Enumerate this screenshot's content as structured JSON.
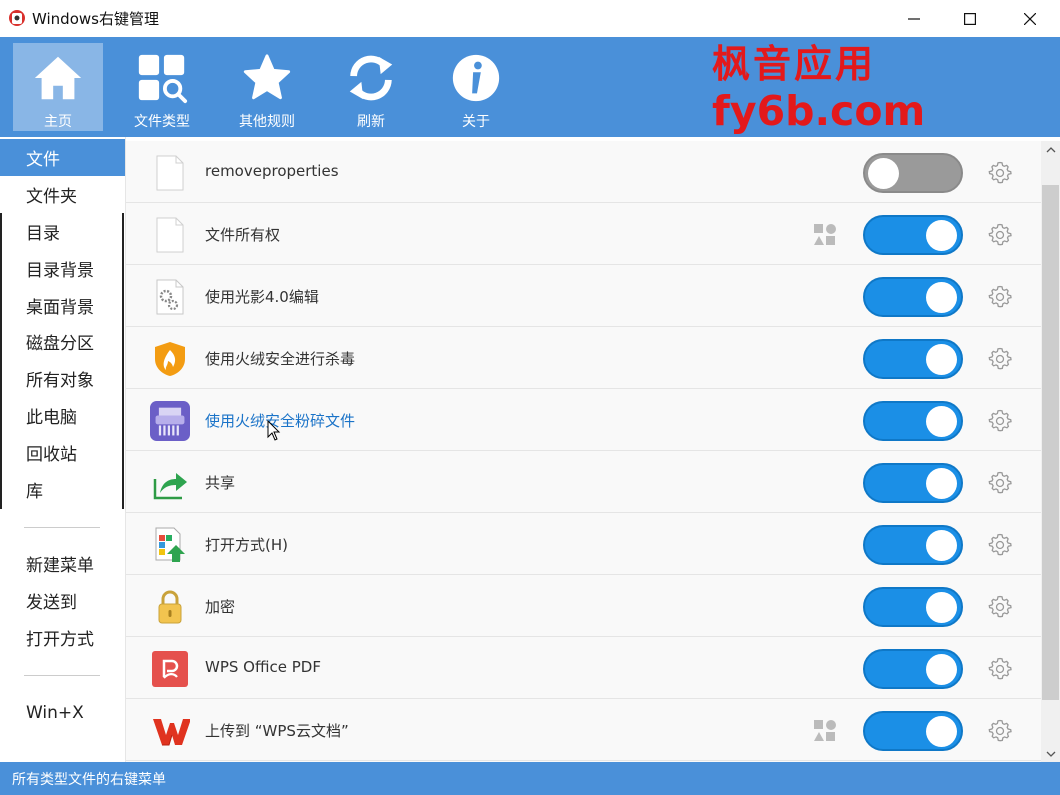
{
  "window": {
    "title": "Windows右键管理"
  },
  "toolbar": {
    "items": [
      {
        "label": "主页",
        "icon": "home-icon",
        "active": true
      },
      {
        "label": "文件类型",
        "icon": "file-types-icon",
        "active": false
      },
      {
        "label": "其他规则",
        "icon": "star-icon",
        "active": false
      },
      {
        "label": "刷新",
        "icon": "refresh-icon",
        "active": false
      },
      {
        "label": "关于",
        "icon": "info-icon",
        "active": false
      }
    ],
    "watermark_line1": "枫音应用",
    "watermark_line2": "fy6b.com"
  },
  "sidebar": {
    "items": [
      {
        "label": "文件",
        "selected": true
      },
      {
        "label": "文件夹"
      },
      {
        "label": "目录"
      },
      {
        "label": "目录背景"
      },
      {
        "label": "桌面背景"
      },
      {
        "label": "磁盘分区"
      },
      {
        "label": "所有对象"
      },
      {
        "label": "此电脑"
      },
      {
        "label": "回收站"
      },
      {
        "label": "库"
      },
      {
        "label": "新建菜单"
      },
      {
        "label": "发送到"
      },
      {
        "label": "打开方式"
      },
      {
        "label": "Win+X"
      }
    ]
  },
  "list": {
    "rows": [
      {
        "name": "removeproperties",
        "icon": "blank-file-icon",
        "enabled": false,
        "shared_badge": false
      },
      {
        "name": "文件所有权",
        "icon": "blank-file-icon",
        "enabled": true,
        "shared_badge": true
      },
      {
        "name": "使用光影4.0编辑",
        "icon": "gear-file-icon",
        "enabled": true,
        "shared_badge": false
      },
      {
        "name": "使用火绒安全进行杀毒",
        "icon": "huorong-shield-icon",
        "enabled": true,
        "shared_badge": false
      },
      {
        "name": "使用火绒安全粉碎文件",
        "icon": "shredder-icon",
        "enabled": true,
        "shared_badge": false,
        "hover": true
      },
      {
        "name": "共享",
        "icon": "share-icon",
        "enabled": true,
        "shared_badge": false
      },
      {
        "name": "打开方式(H)",
        "icon": "open-with-icon",
        "enabled": true,
        "shared_badge": false
      },
      {
        "name": "加密",
        "icon": "lock-icon",
        "enabled": true,
        "shared_badge": false
      },
      {
        "name": "WPS Office PDF",
        "icon": "wps-pdf-icon",
        "enabled": true,
        "shared_badge": false
      },
      {
        "name": "上传到 “WPS云文档”",
        "icon": "wps-logo-icon",
        "enabled": true,
        "shared_badge": true
      }
    ]
  },
  "statusbar": {
    "text": "所有类型文件的右键菜单"
  },
  "colors": {
    "accent": "#4a90d9",
    "toggle_on": "#1b8fe6",
    "toggle_off": "#9a9a9a",
    "watermark": "#e3191b"
  }
}
